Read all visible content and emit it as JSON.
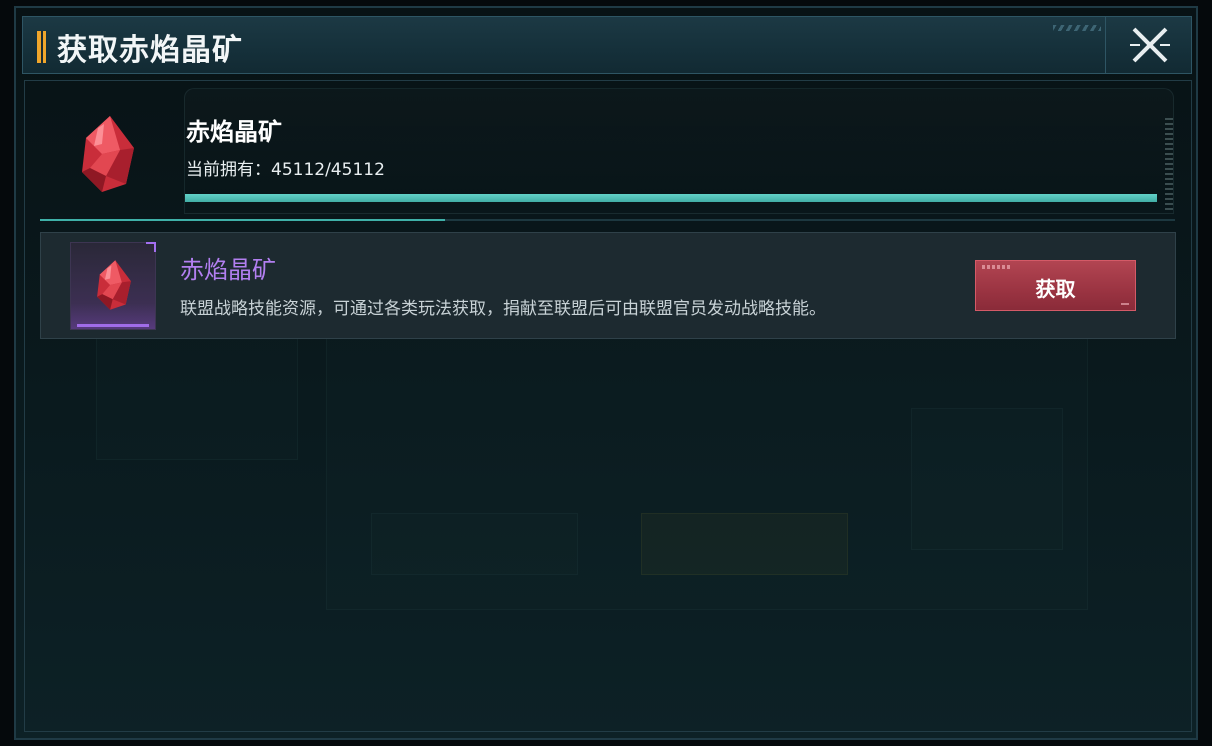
{
  "dialog": {
    "title": "获取赤焰晶矿",
    "close_icon": "close-x-icon"
  },
  "item": {
    "name": "赤焰晶矿",
    "owned_label": "当前拥有：",
    "owned_value": "45112/45112",
    "owned_fraction": 1.0,
    "icon": "red-crystal-icon"
  },
  "source": {
    "title": "赤焰晶矿",
    "description": "联盟战略技能资源，可通过各类玩法获取，捐献至联盟后可由联盟官员发动战略技能。",
    "button_label": "获取",
    "rarity_color": "#a36ff0"
  },
  "colors": {
    "accent_teal": "#42aea6",
    "button_red": "#9b3442",
    "title_accent": "#f0a62b"
  }
}
